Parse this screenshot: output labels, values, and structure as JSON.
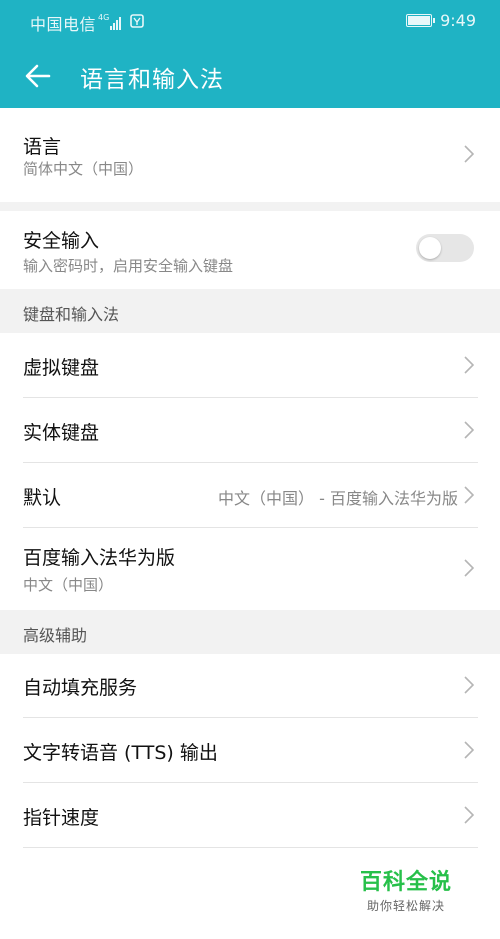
{
  "status_bar": {
    "carrier": "中国电信",
    "network": "4G",
    "time": "9:49",
    "battery_level": 0.95
  },
  "header": {
    "title": "语言和输入法"
  },
  "language": {
    "title": "语言",
    "value": "简体中文（中国）"
  },
  "secure_input": {
    "title": "安全输入",
    "subtitle": "输入密码时，启用安全输入键盘",
    "enabled": false
  },
  "keyboard_section": {
    "header": "键盘和输入法",
    "items": [
      {
        "title": "虚拟键盘"
      },
      {
        "title": "实体键盘"
      },
      {
        "title": "默认",
        "value": "中文（中国） - 百度输入法华为版"
      },
      {
        "title": "百度输入法华为版",
        "subtitle": "中文（中国）"
      }
    ]
  },
  "advanced_section": {
    "header": "高级辅助",
    "items": [
      {
        "title": "自动填充服务"
      },
      {
        "title": "文字转语音 (TTS) 输出"
      },
      {
        "title": "指针速度"
      }
    ]
  },
  "watermark": {
    "main": "百科全说",
    "sub": "助你轻松解决"
  },
  "colors": {
    "accent": "#1fb3c4",
    "section_bg": "#f2f2f2",
    "watermark_green": "#27c04a"
  }
}
